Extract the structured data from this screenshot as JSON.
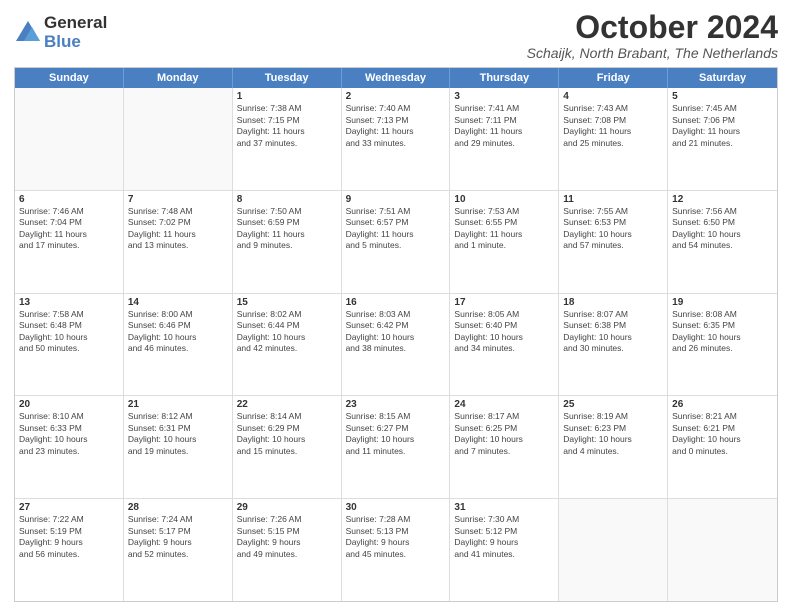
{
  "logo": {
    "general": "General",
    "blue": "Blue"
  },
  "title": "October 2024",
  "location": "Schaijk, North Brabant, The Netherlands",
  "weekdays": [
    "Sunday",
    "Monday",
    "Tuesday",
    "Wednesday",
    "Thursday",
    "Friday",
    "Saturday"
  ],
  "weeks": [
    [
      {
        "day": "",
        "empty": true
      },
      {
        "day": "",
        "empty": true
      },
      {
        "day": "1",
        "lines": [
          "Sunrise: 7:38 AM",
          "Sunset: 7:15 PM",
          "Daylight: 11 hours",
          "and 37 minutes."
        ]
      },
      {
        "day": "2",
        "lines": [
          "Sunrise: 7:40 AM",
          "Sunset: 7:13 PM",
          "Daylight: 11 hours",
          "and 33 minutes."
        ]
      },
      {
        "day": "3",
        "lines": [
          "Sunrise: 7:41 AM",
          "Sunset: 7:11 PM",
          "Daylight: 11 hours",
          "and 29 minutes."
        ]
      },
      {
        "day": "4",
        "lines": [
          "Sunrise: 7:43 AM",
          "Sunset: 7:08 PM",
          "Daylight: 11 hours",
          "and 25 minutes."
        ]
      },
      {
        "day": "5",
        "lines": [
          "Sunrise: 7:45 AM",
          "Sunset: 7:06 PM",
          "Daylight: 11 hours",
          "and 21 minutes."
        ]
      }
    ],
    [
      {
        "day": "6",
        "lines": [
          "Sunrise: 7:46 AM",
          "Sunset: 7:04 PM",
          "Daylight: 11 hours",
          "and 17 minutes."
        ]
      },
      {
        "day": "7",
        "lines": [
          "Sunrise: 7:48 AM",
          "Sunset: 7:02 PM",
          "Daylight: 11 hours",
          "and 13 minutes."
        ]
      },
      {
        "day": "8",
        "lines": [
          "Sunrise: 7:50 AM",
          "Sunset: 6:59 PM",
          "Daylight: 11 hours",
          "and 9 minutes."
        ]
      },
      {
        "day": "9",
        "lines": [
          "Sunrise: 7:51 AM",
          "Sunset: 6:57 PM",
          "Daylight: 11 hours",
          "and 5 minutes."
        ]
      },
      {
        "day": "10",
        "lines": [
          "Sunrise: 7:53 AM",
          "Sunset: 6:55 PM",
          "Daylight: 11 hours",
          "and 1 minute."
        ]
      },
      {
        "day": "11",
        "lines": [
          "Sunrise: 7:55 AM",
          "Sunset: 6:53 PM",
          "Daylight: 10 hours",
          "and 57 minutes."
        ]
      },
      {
        "day": "12",
        "lines": [
          "Sunrise: 7:56 AM",
          "Sunset: 6:50 PM",
          "Daylight: 10 hours",
          "and 54 minutes."
        ]
      }
    ],
    [
      {
        "day": "13",
        "lines": [
          "Sunrise: 7:58 AM",
          "Sunset: 6:48 PM",
          "Daylight: 10 hours",
          "and 50 minutes."
        ]
      },
      {
        "day": "14",
        "lines": [
          "Sunrise: 8:00 AM",
          "Sunset: 6:46 PM",
          "Daylight: 10 hours",
          "and 46 minutes."
        ]
      },
      {
        "day": "15",
        "lines": [
          "Sunrise: 8:02 AM",
          "Sunset: 6:44 PM",
          "Daylight: 10 hours",
          "and 42 minutes."
        ]
      },
      {
        "day": "16",
        "lines": [
          "Sunrise: 8:03 AM",
          "Sunset: 6:42 PM",
          "Daylight: 10 hours",
          "and 38 minutes."
        ]
      },
      {
        "day": "17",
        "lines": [
          "Sunrise: 8:05 AM",
          "Sunset: 6:40 PM",
          "Daylight: 10 hours",
          "and 34 minutes."
        ]
      },
      {
        "day": "18",
        "lines": [
          "Sunrise: 8:07 AM",
          "Sunset: 6:38 PM",
          "Daylight: 10 hours",
          "and 30 minutes."
        ]
      },
      {
        "day": "19",
        "lines": [
          "Sunrise: 8:08 AM",
          "Sunset: 6:35 PM",
          "Daylight: 10 hours",
          "and 26 minutes."
        ]
      }
    ],
    [
      {
        "day": "20",
        "lines": [
          "Sunrise: 8:10 AM",
          "Sunset: 6:33 PM",
          "Daylight: 10 hours",
          "and 23 minutes."
        ]
      },
      {
        "day": "21",
        "lines": [
          "Sunrise: 8:12 AM",
          "Sunset: 6:31 PM",
          "Daylight: 10 hours",
          "and 19 minutes."
        ]
      },
      {
        "day": "22",
        "lines": [
          "Sunrise: 8:14 AM",
          "Sunset: 6:29 PM",
          "Daylight: 10 hours",
          "and 15 minutes."
        ]
      },
      {
        "day": "23",
        "lines": [
          "Sunrise: 8:15 AM",
          "Sunset: 6:27 PM",
          "Daylight: 10 hours",
          "and 11 minutes."
        ]
      },
      {
        "day": "24",
        "lines": [
          "Sunrise: 8:17 AM",
          "Sunset: 6:25 PM",
          "Daylight: 10 hours",
          "and 7 minutes."
        ]
      },
      {
        "day": "25",
        "lines": [
          "Sunrise: 8:19 AM",
          "Sunset: 6:23 PM",
          "Daylight: 10 hours",
          "and 4 minutes."
        ]
      },
      {
        "day": "26",
        "lines": [
          "Sunrise: 8:21 AM",
          "Sunset: 6:21 PM",
          "Daylight: 10 hours",
          "and 0 minutes."
        ]
      }
    ],
    [
      {
        "day": "27",
        "lines": [
          "Sunrise: 7:22 AM",
          "Sunset: 5:19 PM",
          "Daylight: 9 hours",
          "and 56 minutes."
        ]
      },
      {
        "day": "28",
        "lines": [
          "Sunrise: 7:24 AM",
          "Sunset: 5:17 PM",
          "Daylight: 9 hours",
          "and 52 minutes."
        ]
      },
      {
        "day": "29",
        "lines": [
          "Sunrise: 7:26 AM",
          "Sunset: 5:15 PM",
          "Daylight: 9 hours",
          "and 49 minutes."
        ]
      },
      {
        "day": "30",
        "lines": [
          "Sunrise: 7:28 AM",
          "Sunset: 5:13 PM",
          "Daylight: 9 hours",
          "and 45 minutes."
        ]
      },
      {
        "day": "31",
        "lines": [
          "Sunrise: 7:30 AM",
          "Sunset: 5:12 PM",
          "Daylight: 9 hours",
          "and 41 minutes."
        ]
      },
      {
        "day": "",
        "empty": true
      },
      {
        "day": "",
        "empty": true
      }
    ]
  ]
}
